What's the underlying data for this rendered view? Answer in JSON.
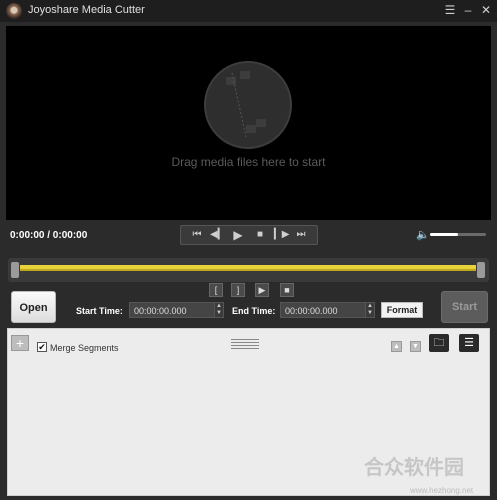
{
  "window": {
    "title": "Joyoshare Media Cutter"
  },
  "preview": {
    "hint": "Drag media files here to start"
  },
  "player": {
    "timecode": "0:00:00 / 0:00:00",
    "volume_level": 0.5
  },
  "controls": {
    "open_label": "Open",
    "start_label": "Start",
    "start_time_label": "Start Time:",
    "start_time_value": "00:00:00.000",
    "end_time_label": "End Time:",
    "end_time_value": "00:00:00.000",
    "format_label": "Format"
  },
  "segments": {
    "merge_label": "Merge Segments",
    "merge_checked": true
  },
  "watermark": {
    "text": "合众软件园",
    "url": "www.hezhong.net"
  },
  "colors": {
    "timeline_accent": "#e8d43a",
    "background": "#2b2b2b"
  },
  "icons": {
    "menu": "menu-icon",
    "minimize": "minimize-icon",
    "close": "close-icon",
    "transport": [
      "skip-back-icon",
      "step-back-icon",
      "play-icon",
      "stop-icon",
      "step-forward-icon",
      "skip-forward-icon"
    ],
    "marks": [
      "mark-in-icon",
      "mark-out-icon",
      "preview-segment-icon",
      "stop-segment-icon"
    ]
  }
}
